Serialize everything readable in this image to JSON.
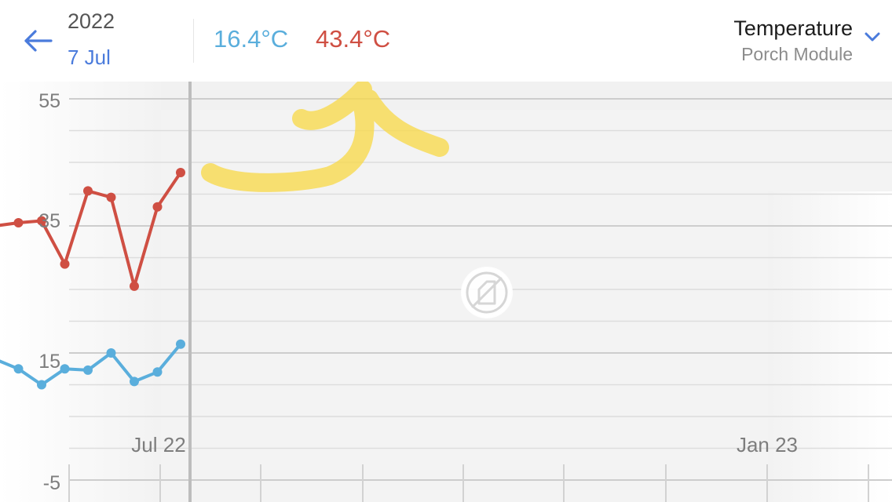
{
  "header": {
    "year": "2022",
    "date": "7 Jul",
    "min_temp": "16.4°C",
    "max_temp": "43.4°C",
    "metric_title": "Temperature",
    "metric_subtitle": "Porch Module"
  },
  "colors": {
    "accent": "#4a7bdc",
    "min_series": "#5aaedc",
    "max_series": "#cf4f43",
    "annotation": "#f7d84a"
  },
  "icons": {
    "back": "arrow-left-icon",
    "dropdown": "chevron-down-icon",
    "no_data": "no-data-icon"
  },
  "chart_data": {
    "type": "line",
    "title": "",
    "xlabel": "",
    "ylabel": "",
    "ylim": [
      -5,
      55
    ],
    "y_ticks": [
      55,
      35,
      15,
      -5
    ],
    "x_tick_labels": [
      "Jul 22",
      "Jan 23"
    ],
    "grid": true,
    "series": [
      {
        "color": "#cf4f43",
        "values": [
          35,
          35.5,
          35.8,
          29,
          40.5,
          39.5,
          25.5,
          38,
          43.4
        ]
      },
      {
        "color": "#5aaedc",
        "values": [
          14,
          12.5,
          10,
          12.5,
          12.3,
          15,
          10.5,
          12,
          16.4
        ]
      }
    ]
  }
}
